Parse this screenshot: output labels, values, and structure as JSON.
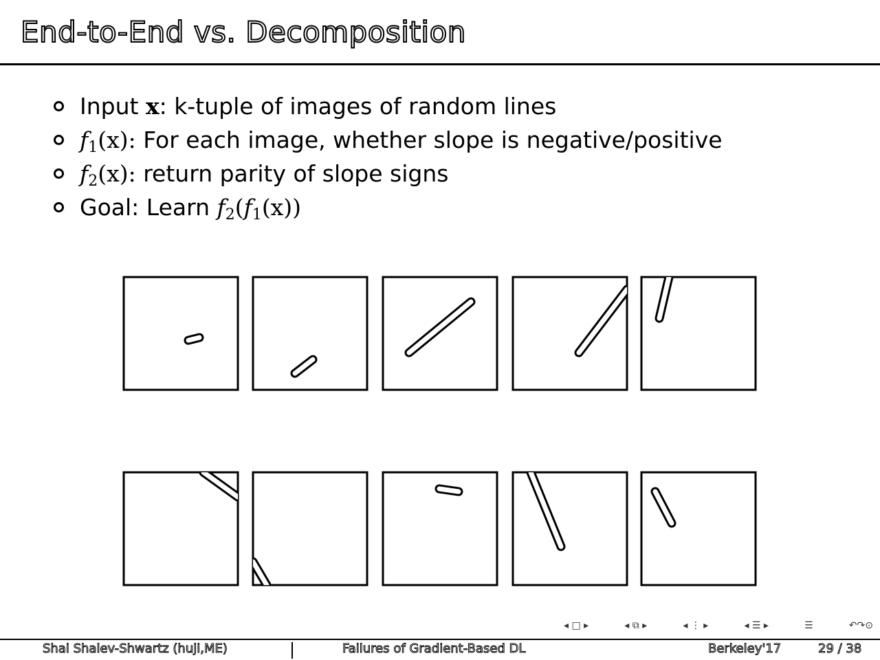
{
  "slide": {
    "title": "End-to-End vs. Decomposition",
    "bullets": [
      {
        "label": "Input",
        "var": "x",
        "sep": ":",
        "text": "k-tuple of images of random lines"
      },
      {
        "fn": "f",
        "sub": "1",
        "arg": "(x):",
        "text": "For each image, whether slope is negative/positive"
      },
      {
        "fn": "f",
        "sub": "2",
        "arg": "(x):",
        "text": "return parity of slope signs"
      },
      {
        "label": "Goal: Learn",
        "expr_f2": "f",
        "expr_sub2": "2",
        "expr_mid": "(",
        "expr_f1": "f",
        "expr_sub1": "1",
        "expr_end": "(x))"
      }
    ]
  },
  "images": {
    "rows": [
      [
        {
          "line": [
            [
              110,
              88
            ],
            [
              94,
              92
            ]
          ]
        },
        {
          "line": [
            [
              87,
              120
            ],
            [
              61,
              140
            ]
          ]
        },
        {
          "line": [
            [
              128,
              36
            ],
            [
              38,
              110
            ]
          ]
        },
        {
          "line": [
            [
              166,
              18
            ],
            [
              96,
              110
            ]
          ]
        },
        {
          "line": [
            [
              40,
              0
            ],
            [
              26,
              60
            ]
          ]
        }
      ],
      [
        {
          "line": [
            [
              116,
              0
            ],
            [
              166,
              36
            ]
          ]
        },
        {
          "line": [
            [
              0,
              130
            ],
            [
              20,
              164
            ]
          ]
        },
        {
          "line": [
            [
              82,
              24
            ],
            [
              110,
              28
            ]
          ]
        },
        {
          "line": [
            [
              26,
              0
            ],
            [
              70,
              108
            ]
          ]
        },
        {
          "line": [
            [
              20,
              28
            ],
            [
              44,
              74
            ]
          ]
        }
      ]
    ]
  },
  "nav": {
    "icons": [
      "◂ □ ▸",
      "◂ ⧉ ▸",
      "◂ ⋮ ▸",
      "◂ ☰ ▸",
      "☰",
      "↶↷⊙"
    ]
  },
  "footer": {
    "author": "Shai Shalev-Shwartz  (huji,ME)",
    "talk": "Failures of Gradient-Based DL",
    "venue": "Berkeley'17",
    "page": "29 / 38"
  }
}
